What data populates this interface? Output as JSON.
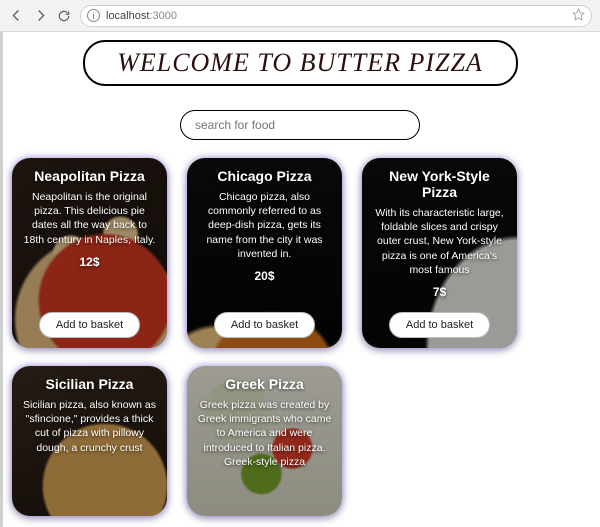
{
  "browser": {
    "url_host": "localhost",
    "url_port": ":3000"
  },
  "hero": {
    "title": "WELCOME TO BUTTER PIZZA"
  },
  "search": {
    "placeholder": "search for food"
  },
  "buttons": {
    "add": "Add to basket"
  },
  "cards": [
    {
      "title": "Neapolitan Pizza",
      "desc": "Neapolitan is the original pizza. This delicious pie dates all the way back to 18th century in Naples, Italy.",
      "price": "12$",
      "bg": "bg-neapolitan",
      "has_button": true
    },
    {
      "title": "Chicago Pizza",
      "desc": "Chicago pizza, also commonly referred to as deep-dish pizza, gets its name from the city it was invented in.",
      "price": "20$",
      "bg": "bg-chicago",
      "has_button": true
    },
    {
      "title": "New York-Style Pizza",
      "desc": "With its characteristic large, foldable slices and crispy outer crust, New York-style pizza is one of America's most famous",
      "price": "7$",
      "bg": "bg-ny",
      "has_button": true
    },
    {
      "title": "Sicilian Pizza",
      "desc": "Sicilian pizza, also known as \"sfincione,\" provides a thick cut of pizza with pillowy dough, a crunchy crust",
      "price": "",
      "bg": "bg-sicilian",
      "has_button": false
    },
    {
      "title": "Greek Pizza",
      "desc": "Greek pizza was created by Greek immigrants who came to America and were introduced to Italian pizza. Greek-style pizza",
      "price": "",
      "bg": "bg-greek",
      "has_button": false
    }
  ]
}
